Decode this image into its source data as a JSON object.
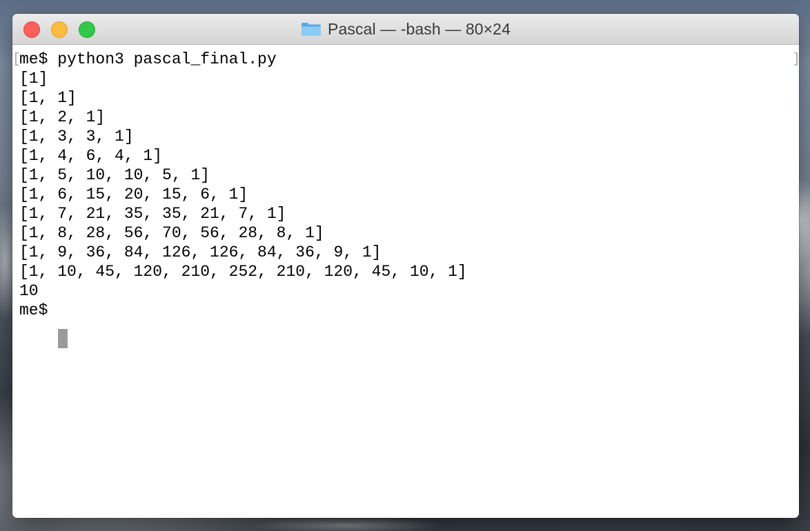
{
  "window": {
    "title": "Pascal — -bash — 80×24",
    "folder_icon": "folder-icon"
  },
  "terminal": {
    "left_bracket": "[",
    "right_bracket": "]",
    "lines": [
      "me$ python3 pascal_final.py",
      "[1]",
      "[1, 1]",
      "[1, 2, 1]",
      "[1, 3, 3, 1]",
      "[1, 4, 6, 4, 1]",
      "[1, 5, 10, 10, 5, 1]",
      "[1, 6, 15, 20, 15, 6, 1]",
      "[1, 7, 21, 35, 35, 21, 7, 1]",
      "[1, 8, 28, 56, 70, 56, 28, 8, 1]",
      "[1, 9, 36, 84, 126, 126, 84, 36, 9, 1]",
      "[1, 10, 45, 120, 210, 252, 210, 120, 45, 10, 1]",
      "10",
      "me$ "
    ]
  },
  "colors": {
    "close": "#fc605c",
    "minimize": "#fdbc40",
    "zoom": "#34c84a",
    "folder": "#6cb8ec"
  }
}
